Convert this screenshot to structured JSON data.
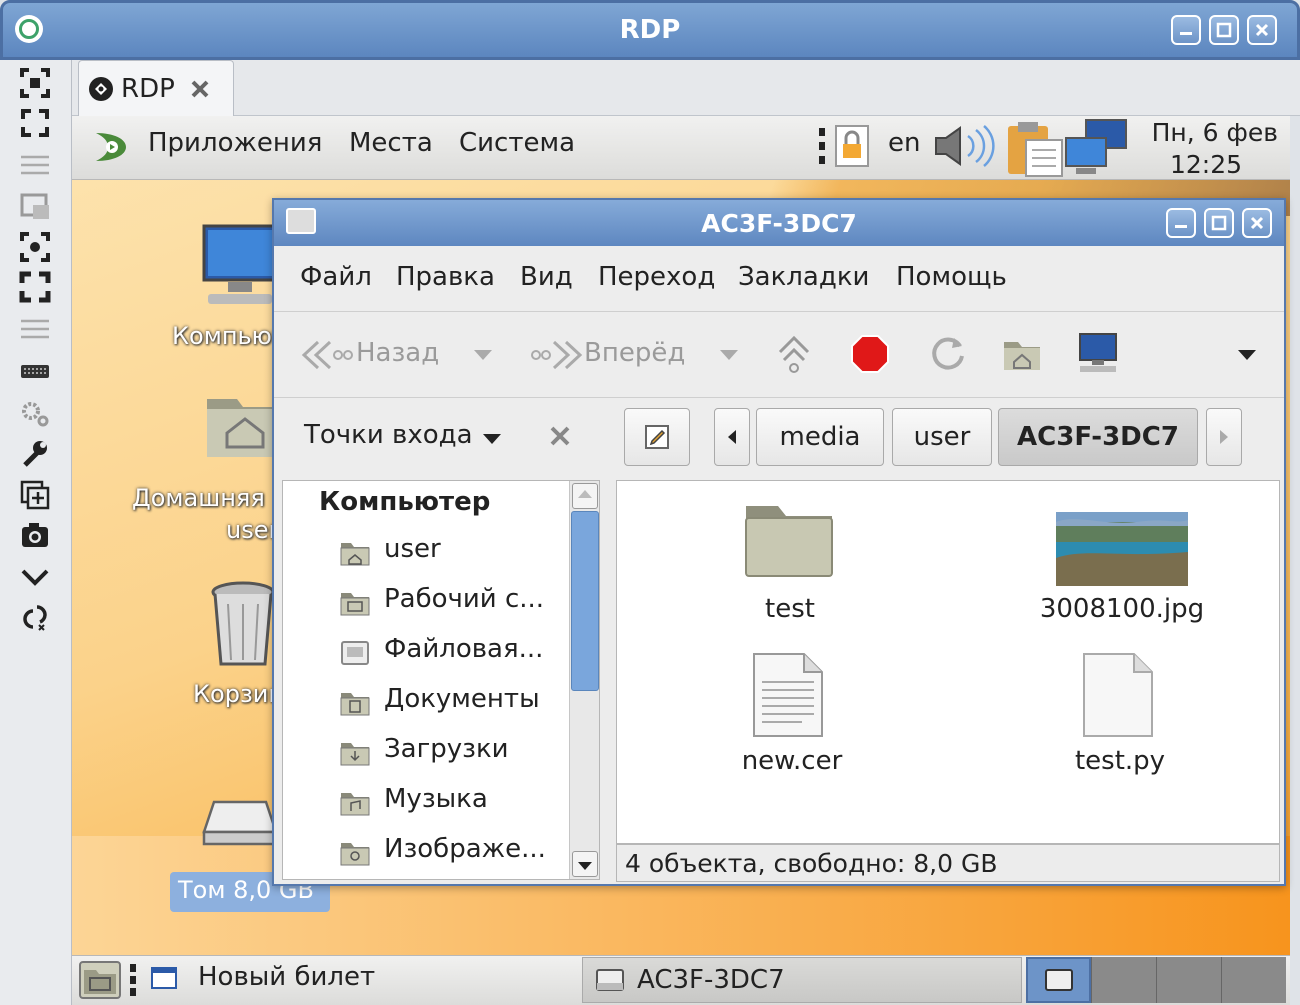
{
  "outer_window": {
    "title": "RDP"
  },
  "tab": {
    "label": "RDP"
  },
  "panel": {
    "menu": [
      "Приложения",
      "Места",
      "Система"
    ],
    "lang": "en",
    "date": "Пн,  6 фев",
    "time": "12:25"
  },
  "desktop": {
    "icons": [
      "Компьютер",
      "Домашняя",
      "user",
      "Корзина"
    ],
    "volume_label": "Том 8,0 GB"
  },
  "file_manager": {
    "title": "AC3F-3DC7",
    "menu": [
      "Файл",
      "Правка",
      "Вид",
      "Переход",
      "Закладки",
      "Помощь"
    ],
    "toolbar": {
      "back": "Назад",
      "forward": "Вперёд"
    },
    "sidebar_title": "Точки входа",
    "sidebar_header": "Компьютер",
    "sidebar_items": [
      "user",
      "Рабочий с...",
      "Файловая...",
      "Документы",
      "Загрузки",
      "Музыка",
      "Изображе..."
    ],
    "path": [
      "media",
      "user",
      "AC3F-3DC7"
    ],
    "files": [
      "test",
      "3008100.jpg",
      "new.cer",
      "test.py"
    ],
    "status": "4 объекта, свободно: 8,0 GB"
  },
  "taskbar": {
    "items": [
      "Новый билет",
      "AC3F-3DC7"
    ]
  },
  "colors": {
    "titlebar": "#5c86bf",
    "desktop_accent": "#f7941d",
    "selection": "#8db0de"
  }
}
